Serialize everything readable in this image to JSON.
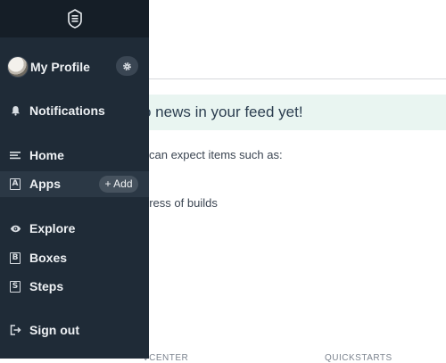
{
  "sidebar": {
    "profile": {
      "label": "My Profile"
    },
    "notifications": {
      "label": "Notifications"
    },
    "home": {
      "label": "Home"
    },
    "apps": {
      "label": "Apps",
      "letter": "A",
      "add_label": "+ Add"
    },
    "explore": {
      "label": "Explore"
    },
    "boxes": {
      "label": "Boxes",
      "letter": "B"
    },
    "steps": {
      "label": "Steps",
      "letter": "S"
    },
    "signout": {
      "label": "Sign out"
    }
  },
  "main": {
    "feed_banner": "o news in your feed yet!",
    "intro_text": "can expect items such as:",
    "progress_text": "gress of builds",
    "footer_dev": "VCENTER",
    "footer_quick": "QUICKSTARTS"
  },
  "colors": {
    "sidebar_bg": "#1f2b37",
    "sidebar_topbar": "#151e27",
    "active_item": "#2b3845",
    "banner_bg": "#e9f5f1"
  },
  "icons": {
    "logo": "bitrise-logo-icon",
    "gear": "gear-icon",
    "bell": "bell-icon",
    "home": "menu-lines-icon",
    "explore": "eye-icon",
    "signout": "sign-out-icon"
  }
}
